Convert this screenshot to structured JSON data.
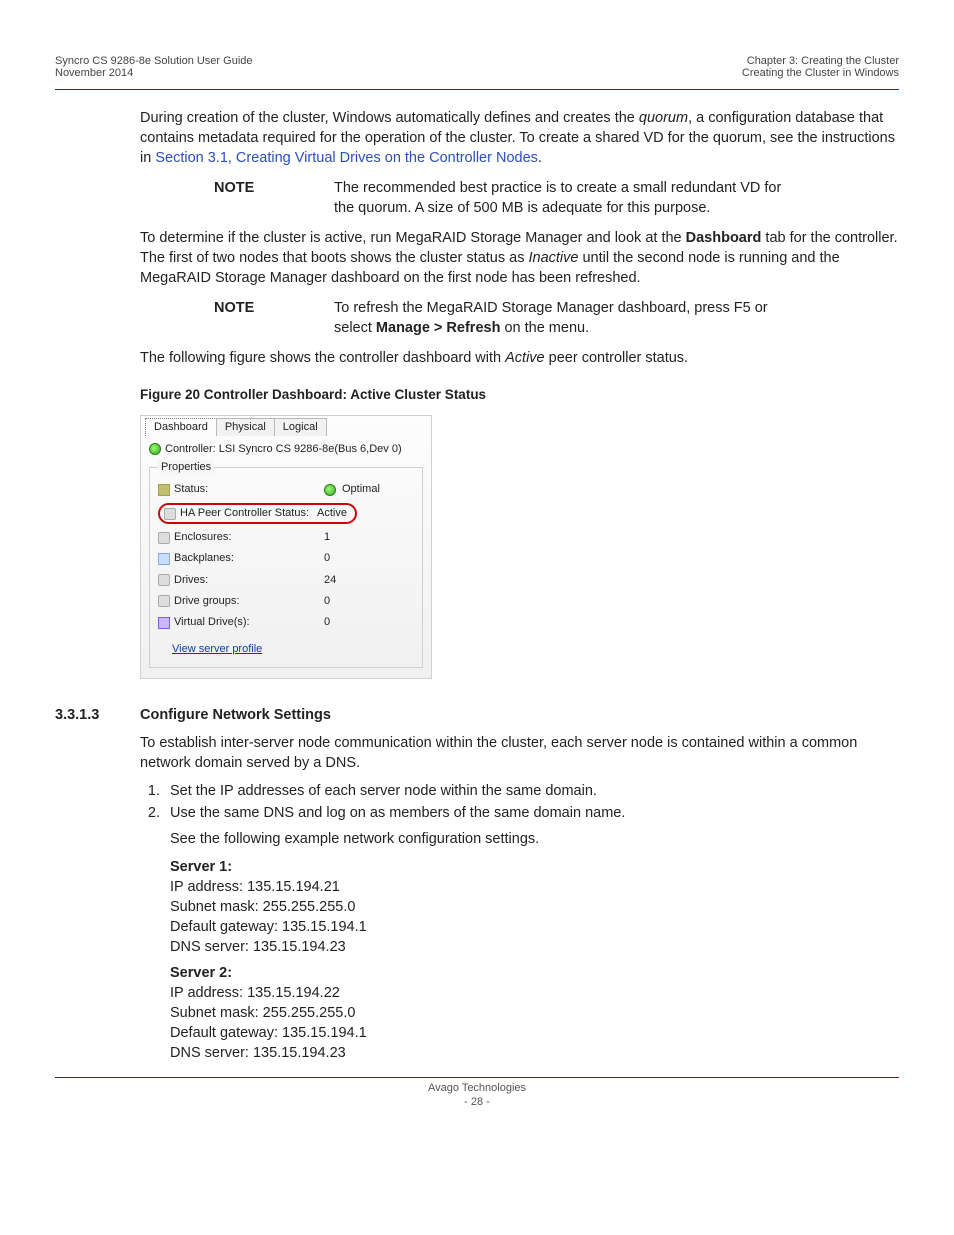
{
  "header": {
    "left_line1": "Syncro CS 9286-8e Solution User Guide",
    "left_line2": "November 2014",
    "right_line1": "Chapter 3: Creating the Cluster",
    "right_line2": "Creating the Cluster in Windows"
  },
  "body": {
    "p1_a": "During creation of the cluster, Windows automatically defines and creates the ",
    "p1_quorum": "quorum",
    "p1_b": ", a configuration database that contains metadata required for the operation of the cluster. To create a shared VD for the quorum, see the instructions in ",
    "p1_link": "Section 3.1, Creating Virtual Drives on the Controller Nodes",
    "p1_c": ".",
    "note1_label": "NOTE",
    "note1_text": "The recommended best practice is to create a small redundant VD for the quorum. A size of 500 MB is adequate for this purpose.",
    "p2_a": "To determine if the cluster is active, run MegaRAID Storage Manager and look at the ",
    "p2_bold": "Dashboard",
    "p2_b": " tab for the controller. The first of two nodes that boots shows the cluster status as ",
    "p2_italic": "Inactive",
    "p2_c": " until the second node is running and the MegaRAID Storage Manager dashboard on the first node has been refreshed.",
    "note2_label": "NOTE",
    "note2_a": "To refresh the MegaRAID Storage Manager dashboard, press F5 or select ",
    "note2_bold": "Manage > Refresh",
    "note2_b": " on the menu.",
    "p3_a": "The following figure shows the controller dashboard with ",
    "p3_italic": "Active",
    "p3_b": " peer controller status.",
    "figcap": "Figure 20  Controller Dashboard: Active Cluster Status"
  },
  "dashboard": {
    "tabs": {
      "t0": "Dashboard",
      "t1": "Physical",
      "t2": "Logical"
    },
    "controller_label": "Controller: LSI Syncro CS 9286-8e(Bus 6,Dev 0)",
    "legend": "Properties",
    "status_label": "Status:",
    "status_value": "Optimal",
    "ha_label": "HA Peer Controller Status:",
    "ha_value": "Active",
    "enclosures_label": "Enclosures:",
    "enclosures_value": "1",
    "backplanes_label": "Backplanes:",
    "backplanes_value": "0",
    "drives_label": "Drives:",
    "drives_value": "24",
    "drivegroups_label": "Drive groups:",
    "drivegroups_value": "0",
    "vd_label": "Virtual Drive(s):",
    "vd_value": "0",
    "view_link": "View server profile"
  },
  "section": {
    "num": "3.3.1.3",
    "title": "Configure Network Settings",
    "intro": "To establish inter-server node communication within the cluster, each server node is contained within a common network domain served by a DNS.",
    "li1": "Set the IP addresses of each server node within the same domain.",
    "li2": "Use the same DNS and log on as members of the same domain name.",
    "li2b": "See the following example network configuration settings.",
    "s1_title": "Server 1:",
    "s1_ip": "IP address: 135.15.194.21",
    "s1_mask": "Subnet mask: 255.255.255.0",
    "s1_gw": "Default gateway: 135.15.194.1",
    "s1_dns": "DNS server: 135.15.194.23",
    "s2_title": "Server 2:",
    "s2_ip": "IP address: 135.15.194.22",
    "s2_mask": "Subnet mask: 255.255.255.0",
    "s2_gw": "Default gateway: 135.15.194.1",
    "s2_dns": "DNS server: 135.15.194.23"
  },
  "footer": {
    "company": "Avago Technologies",
    "page": "- 28 -"
  }
}
